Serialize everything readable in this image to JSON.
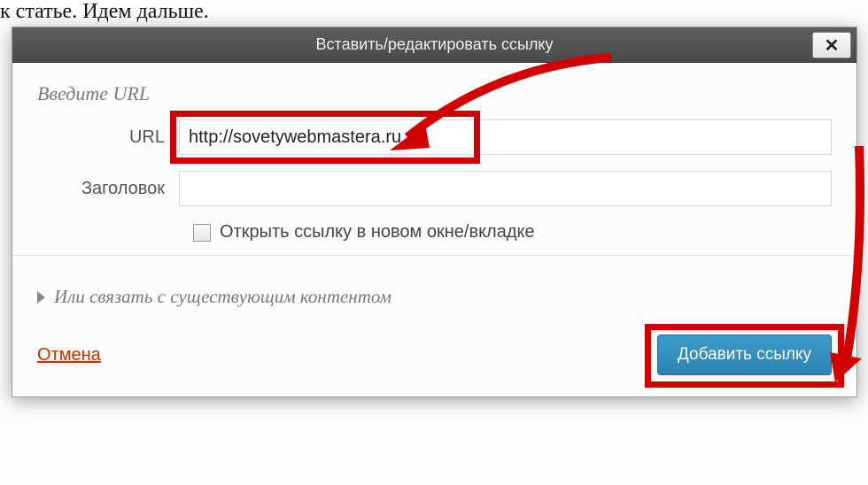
{
  "background": {
    "top_text": "к статье. Идем дальше.",
    "bottom_text": ""
  },
  "dialog": {
    "title": "Вставить/редактировать ссылку",
    "close_icon": "✕",
    "section_enter_url": "Введите URL",
    "url_label": "URL",
    "url_value": "http://sovetywebmastera.ru",
    "title_label": "Заголовок",
    "title_value": "",
    "checkbox_label": "Открыть ссылку в новом окне/вкладке",
    "link_existing_label": "Или связать с существующим контентом",
    "cancel_label": "Отмена",
    "submit_label": "Добавить ссылку"
  },
  "annotations": {
    "arrow_color": "#d20000",
    "highlight_color": "#d20000"
  }
}
